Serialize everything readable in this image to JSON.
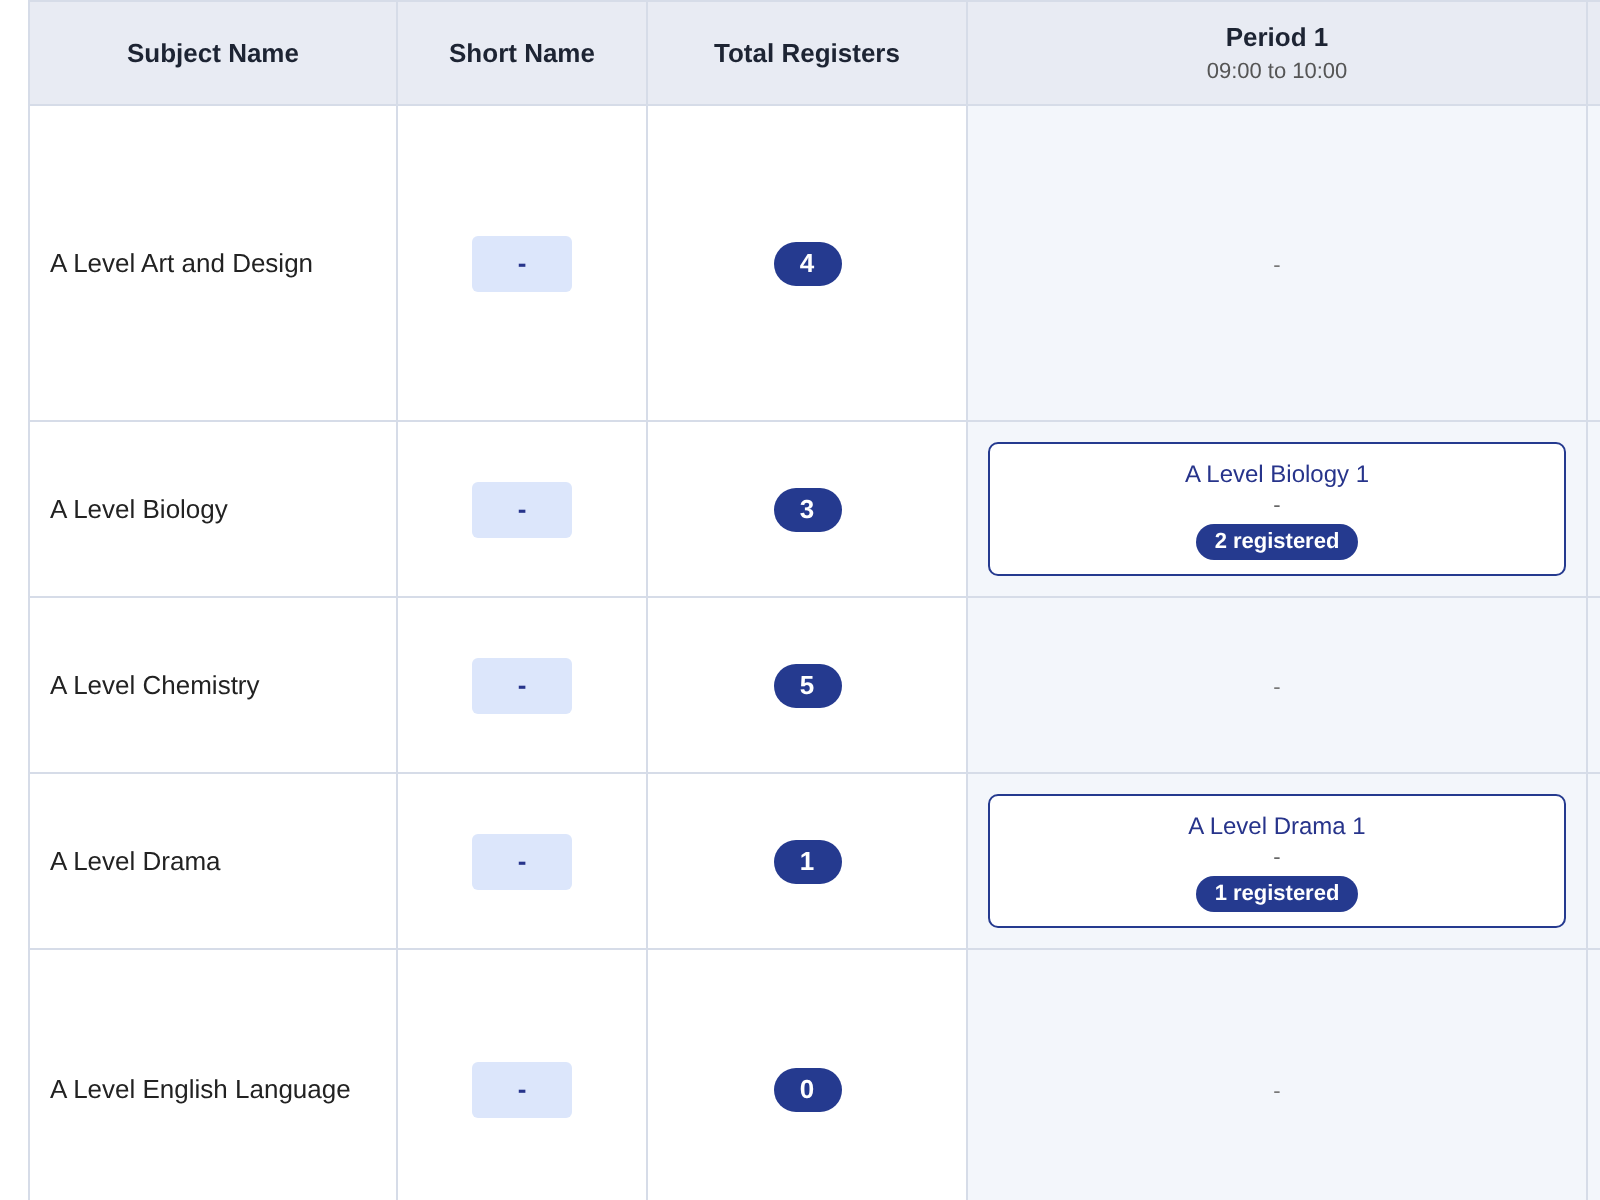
{
  "table": {
    "columns": [
      {
        "label": "Subject Name"
      },
      {
        "label": "Short Name"
      },
      {
        "label": "Total Registers"
      },
      {
        "label": "Period 1",
        "time": "09:00 to 10:00"
      }
    ],
    "rows": [
      {
        "subject": "A Level Art and Design",
        "short_name": "-",
        "total": "4",
        "period_1": {
          "kind": "empty",
          "text": "-"
        }
      },
      {
        "subject": "A Level Biology",
        "short_name": "-",
        "total": "3",
        "period_1": {
          "kind": "class",
          "title": "A Level Biology 1",
          "detail": "-",
          "registered": "2 registered"
        }
      },
      {
        "subject": "A Level Chemistry",
        "short_name": "-",
        "total": "5",
        "period_1": {
          "kind": "empty",
          "text": "-"
        }
      },
      {
        "subject": "A Level Drama",
        "short_name": "-",
        "total": "1",
        "period_1": {
          "kind": "class",
          "title": "A Level Drama 1",
          "detail": "-",
          "registered": "1 registered"
        }
      },
      {
        "subject": "A Level English Language",
        "short_name": "-",
        "total": "0",
        "period_1": {
          "kind": "empty",
          "text": "-"
        }
      }
    ]
  }
}
